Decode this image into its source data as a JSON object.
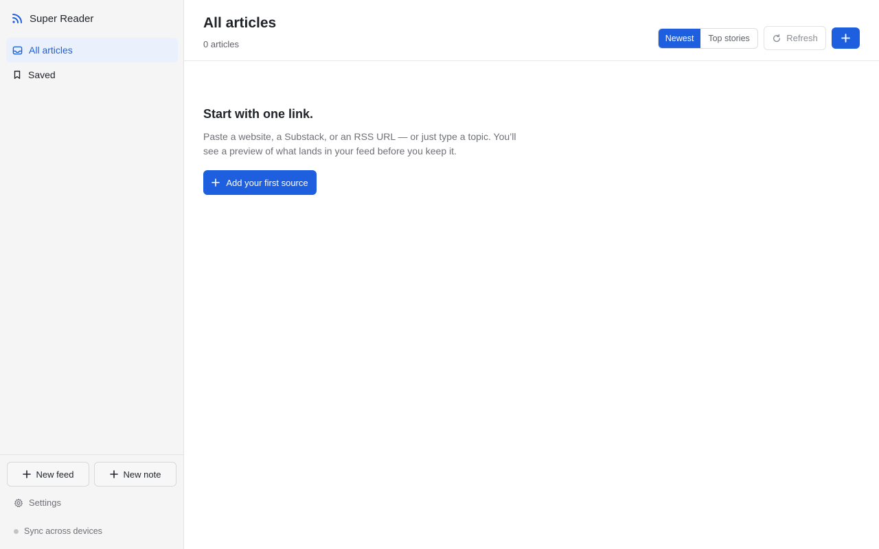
{
  "app": {
    "title": "Super Reader"
  },
  "sidebar": {
    "items": [
      {
        "label": "All articles",
        "icon": "inbox-icon",
        "active": true
      },
      {
        "label": "Saved",
        "icon": "bookmark-icon",
        "active": false
      }
    ],
    "footer": {
      "new_feed_label": "New feed",
      "new_note_label": "New note",
      "settings_label": "Settings",
      "sync_label": "Sync across devices"
    }
  },
  "header": {
    "title": "All articles",
    "count": "0 articles",
    "sort_options": [
      "Newest",
      "Top stories"
    ],
    "sort_selected": "Newest",
    "refresh_label": "Refresh",
    "add_icon": "plus-icon"
  },
  "empty_state": {
    "title": "Start with one link.",
    "description": "Paste a website, a Substack, or an RSS URL — or just type a topic. You’ll see a preview of what lands in your feed before you keep it.",
    "cta_label": "Add your first source"
  },
  "colors": {
    "accent": "#1e5fe0",
    "active_bg": "#eaf1fd",
    "sidebar_bg": "#f5f5f5"
  }
}
